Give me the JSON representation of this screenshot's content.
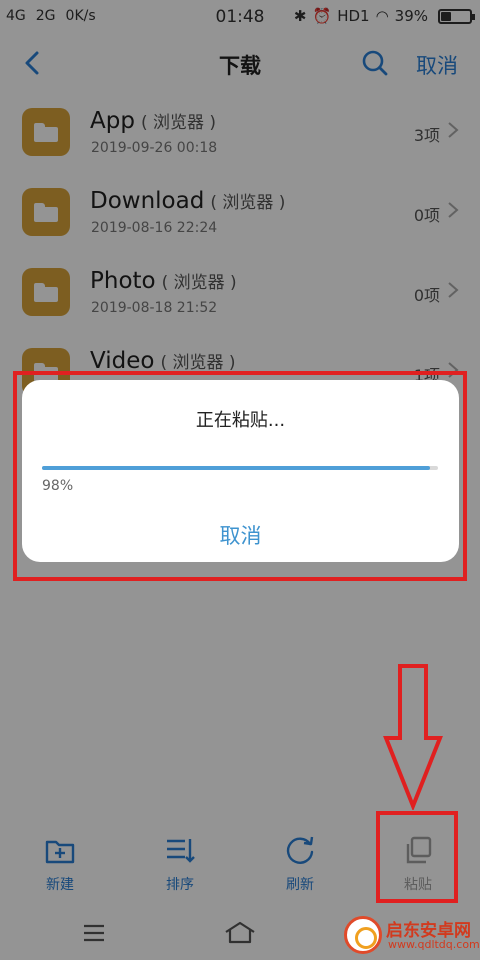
{
  "status_bar": {
    "signal_1": "4G",
    "signal_2": "2G",
    "speed": "0K/s",
    "time": "01:48",
    "network": "HD1",
    "battery": "39%",
    "battery_level": 0.39
  },
  "header": {
    "title": "下载",
    "cancel_label": "取消"
  },
  "files": [
    {
      "name": "App",
      "tag": "( 浏览器 )",
      "date": "2019-09-26 00:18",
      "count": "3项"
    },
    {
      "name": "Download",
      "tag": "( 浏览器 )",
      "date": "2019-08-16 22:24",
      "count": "0项"
    },
    {
      "name": "Photo",
      "tag": "( 浏览器 )",
      "date": "2019-08-18 21:52",
      "count": "0项"
    },
    {
      "name": "Video",
      "tag": "( 浏览器 )",
      "date": "",
      "count": "1项"
    }
  ],
  "dialog": {
    "title": "正在粘贴...",
    "progress": 0.98,
    "progress_text": "98%",
    "cancel_label": "取消"
  },
  "toolbar": {
    "new_label": "新建",
    "sort_label": "排序",
    "refresh_label": "刷新",
    "paste_label": "粘贴"
  },
  "watermark": {
    "title": "启东安卓网",
    "url": "www.qdltdq.com"
  },
  "colors": {
    "accent": "#2a7fd4",
    "folder": "#d7a33a",
    "progress": "#4f9fd8",
    "annotation": "#e02020"
  }
}
